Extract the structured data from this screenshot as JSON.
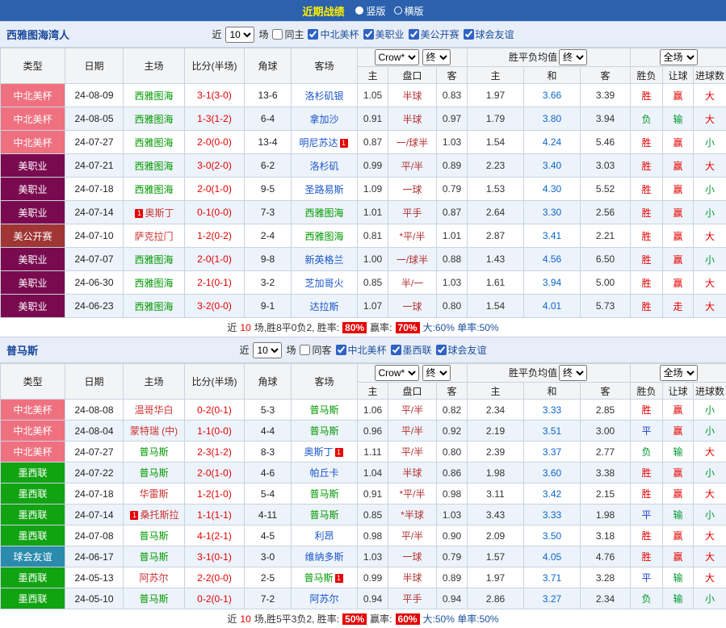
{
  "top_bar": {
    "title": "近期战绩",
    "options": [
      {
        "label": "竖版",
        "selected": true
      },
      {
        "label": "横版",
        "selected": false
      }
    ]
  },
  "headers": {
    "main": [
      "类型",
      "日期",
      "主场",
      "比分(半场)",
      "角球",
      "客场"
    ],
    "sub": [
      "主",
      "盘口",
      "客",
      "主",
      "和",
      "客",
      "胜负",
      "让球",
      "进球数"
    ],
    "odds_avg": "胜平负均值"
  },
  "controls": {
    "near": "近",
    "count": "10",
    "matches": "场",
    "company": "Crow*",
    "final": "终",
    "full": "全场"
  },
  "colors": {
    "top_bar": "#2b61ad",
    "leagues": {
      "中北美杯": "#ef7180",
      "美职业": "#7a0a50",
      "美公开赛": "#a03535",
      "墨西联": "#12a312",
      "球会友谊": "#2a8bad"
    },
    "results": {
      "胜": "#e60000",
      "赢": "#e60000",
      "大": "#e60000",
      "走": "#e60000",
      "负": "#009933",
      "输": "#009933",
      "小": "#009933",
      "平": "#2244cc"
    },
    "team": {
      "focus": "#009900",
      "home_opponent": "#cc3333",
      "away_opponent": "#1a56cc"
    }
  },
  "sections": {
    "seattle": {
      "title": "西雅图海湾人",
      "same_filter": "同主",
      "leagues": [
        {
          "name": "中北美杯"
        },
        {
          "name": "美职业"
        },
        {
          "name": "美公开赛"
        },
        {
          "name": "球会友谊"
        }
      ],
      "rows": [
        {
          "league": "中北美杯",
          "date": "24-08-09",
          "home": "西雅图海",
          "home_side": "focus",
          "score": "3-1(3-0)",
          "corners": "13-6",
          "away": "洛杉矶银",
          "away_side": "opp",
          "ah_home": "1.05",
          "ah_line": "半球",
          "ah_away": "0.83",
          "avg_home": "1.97",
          "avg_draw": "3.66",
          "avg_away": "3.39",
          "res_wdl": "胜",
          "res_ah": "赢",
          "res_goal": "大"
        },
        {
          "league": "中北美杯",
          "date": "24-08-05",
          "home": "西雅图海",
          "home_side": "focus",
          "score": "1-3(1-2)",
          "corners": "6-4",
          "away": "拿加沙",
          "away_side": "opp",
          "ah_home": "0.91",
          "ah_line": "半球",
          "ah_away": "0.97",
          "avg_home": "1.79",
          "avg_draw": "3.80",
          "avg_away": "3.94",
          "res_wdl": "负",
          "res_ah": "输",
          "res_goal": "大"
        },
        {
          "league": "中北美杯",
          "date": "24-07-27",
          "home": "西雅图海",
          "home_side": "focus",
          "score": "2-0(0-0)",
          "corners": "13-4",
          "away": "明尼苏达",
          "away_side": "opp",
          "away_card_a": "1",
          "ah_home": "0.87",
          "ah_line": "一/球半",
          "ah_away": "1.03",
          "avg_home": "1.54",
          "avg_draw": "4.24",
          "avg_away": "5.46",
          "res_wdl": "胜",
          "res_ah": "赢",
          "res_goal": "小"
        },
        {
          "league": "美职业",
          "date": "24-07-21",
          "home": "西雅图海",
          "home_side": "focus",
          "score": "3-0(2-0)",
          "corners": "6-2",
          "away": "洛杉矶",
          "away_side": "opp",
          "ah_home": "0.99",
          "ah_line": "平/半",
          "ah_away": "0.89",
          "avg_home": "2.23",
          "avg_draw": "3.40",
          "avg_away": "3.03",
          "res_wdl": "胜",
          "res_ah": "赢",
          "res_goal": "大"
        },
        {
          "league": "美职业",
          "date": "24-07-18",
          "home": "西雅图海",
          "home_side": "focus",
          "score": "2-0(1-0)",
          "corners": "9-5",
          "away": "圣路易斯",
          "away_side": "opp",
          "ah_home": "1.09",
          "ah_line": "一球",
          "ah_away": "0.79",
          "avg_home": "1.53",
          "avg_draw": "4.30",
          "avg_away": "5.52",
          "res_wdl": "胜",
          "res_ah": "赢",
          "res_goal": "小"
        },
        {
          "league": "美职业",
          "date": "24-07-14",
          "home": "奥斯丁",
          "home_side": "opp",
          "home_card_b": "1",
          "score": "0-1(0-0)",
          "corners": "7-3",
          "away": "西雅图海",
          "away_side": "focus",
          "ah_home": "1.01",
          "ah_line": "平手",
          "ah_away": "0.87",
          "avg_home": "2.64",
          "avg_draw": "3.30",
          "avg_away": "2.56",
          "res_wdl": "胜",
          "res_ah": "赢",
          "res_goal": "小"
        },
        {
          "league": "美公开赛",
          "date": "24-07-10",
          "home": "萨克拉门",
          "home_side": "opp",
          "score": "1-2(0-2)",
          "corners": "2-4",
          "away": "西雅图海",
          "away_side": "focus",
          "ah_home": "0.81",
          "ah_line": "*平/半",
          "ah_away": "1.01",
          "avg_home": "2.87",
          "avg_draw": "3.41",
          "avg_away": "2.21",
          "res_wdl": "胜",
          "res_ah": "赢",
          "res_goal": "大"
        },
        {
          "league": "美职业",
          "date": "24-07-07",
          "home": "西雅图海",
          "home_side": "focus",
          "score": "2-0(1-0)",
          "corners": "9-8",
          "away": "新英格兰",
          "away_side": "opp",
          "ah_home": "1.00",
          "ah_line": "一/球半",
          "ah_away": "0.88",
          "avg_home": "1.43",
          "avg_draw": "4.56",
          "avg_away": "6.50",
          "res_wdl": "胜",
          "res_ah": "赢",
          "res_goal": "小"
        },
        {
          "league": "美职业",
          "date": "24-06-30",
          "home": "西雅图海",
          "home_side": "focus",
          "score": "2-1(0-1)",
          "corners": "3-2",
          "away": "芝加哥火",
          "away_side": "opp",
          "ah_home": "0.85",
          "ah_line": "半/一",
          "ah_away": "1.03",
          "avg_home": "1.61",
          "avg_draw": "3.94",
          "avg_away": "5.00",
          "res_wdl": "胜",
          "res_ah": "赢",
          "res_goal": "大"
        },
        {
          "league": "美职业",
          "date": "24-06-23",
          "home": "西雅图海",
          "home_side": "focus",
          "score": "3-2(0-0)",
          "corners": "9-1",
          "away": "达拉斯",
          "away_side": "opp",
          "ah_home": "1.07",
          "ah_line": "一球",
          "ah_away": "0.80",
          "avg_home": "1.54",
          "avg_draw": "4.01",
          "avg_away": "5.73",
          "res_wdl": "胜",
          "res_ah": "走",
          "res_goal": "大"
        }
      ],
      "summary": {
        "prefix": "近",
        "count": "10",
        "mid": "场,胜8平0负2, 胜率:",
        "rate1": "80%",
        "label2": "赢率:",
        "rate2": "70%",
        "tail": "大:60% 单率:50%"
      }
    },
    "pumas": {
      "title": "普马斯",
      "same_filter": "同客",
      "leagues": [
        {
          "name": "中北美杯"
        },
        {
          "name": "墨西联"
        },
        {
          "name": "球会友谊"
        }
      ],
      "rows": [
        {
          "league": "中北美杯",
          "date": "24-08-08",
          "home": "温哥华白",
          "home_side": "opp",
          "score": "0-2(0-1)",
          "corners": "5-3",
          "away": "普马斯",
          "away_side": "focus",
          "ah_home": "1.06",
          "ah_line": "平/半",
          "ah_away": "0.82",
          "avg_home": "2.34",
          "avg_draw": "3.33",
          "avg_away": "2.85",
          "res_wdl": "胜",
          "res_ah": "赢",
          "res_goal": "小"
        },
        {
          "league": "中北美杯",
          "date": "24-08-04",
          "home": "蒙特瑞 (中)",
          "home_side": "opp",
          "score": "1-1(0-0)",
          "corners": "4-4",
          "away": "普马斯",
          "away_side": "focus",
          "ah_home": "0.96",
          "ah_line": "平/半",
          "ah_away": "0.92",
          "avg_home": "2.19",
          "avg_draw": "3.51",
          "avg_away": "3.00",
          "res_wdl": "平",
          "res_ah": "赢",
          "res_goal": "小"
        },
        {
          "league": "中北美杯",
          "date": "24-07-27",
          "home": "普马斯",
          "home_side": "focus",
          "score": "2-3(1-2)",
          "corners": "8-3",
          "away": "奥斯丁",
          "away_side": "opp",
          "away_card_a": "1",
          "ah_home": "1.11",
          "ah_line": "平/半",
          "ah_away": "0.80",
          "avg_home": "2.39",
          "avg_draw": "3.37",
          "avg_away": "2.77",
          "res_wdl": "负",
          "res_ah": "输",
          "res_goal": "大"
        },
        {
          "league": "墨西联",
          "date": "24-07-22",
          "home": "普马斯",
          "home_side": "focus",
          "score": "2-0(1-0)",
          "corners": "4-6",
          "away": "帕丘卡",
          "away_side": "opp",
          "ah_home": "1.04",
          "ah_line": "半球",
          "ah_away": "0.86",
          "avg_home": "1.98",
          "avg_draw": "3.60",
          "avg_away": "3.38",
          "res_wdl": "胜",
          "res_ah": "赢",
          "res_goal": "小"
        },
        {
          "league": "墨西联",
          "date": "24-07-18",
          "home": "华雷斯",
          "home_side": "opp",
          "score": "1-2(1-0)",
          "corners": "5-4",
          "away": "普马斯",
          "away_side": "focus",
          "ah_home": "0.91",
          "ah_line": "*平/半",
          "ah_away": "0.98",
          "avg_home": "3.11",
          "avg_draw": "3.42",
          "avg_away": "2.15",
          "res_wdl": "胜",
          "res_ah": "赢",
          "res_goal": "大"
        },
        {
          "league": "墨西联",
          "date": "24-07-14",
          "home": "桑托斯拉",
          "home_side": "opp",
          "home_card_b": "1",
          "score": "1-1(1-1)",
          "corners": "4-11",
          "away": "普马斯",
          "away_side": "focus",
          "ah_home": "0.85",
          "ah_line": "*半球",
          "ah_away": "1.03",
          "avg_home": "3.43",
          "avg_draw": "3.33",
          "avg_away": "1.98",
          "res_wdl": "平",
          "res_ah": "输",
          "res_goal": "小"
        },
        {
          "league": "墨西联",
          "date": "24-07-08",
          "home": "普马斯",
          "home_side": "focus",
          "score": "4-1(2-1)",
          "corners": "4-5",
          "away": "利昂",
          "away_side": "opp",
          "ah_home": "0.98",
          "ah_line": "平/半",
          "ah_away": "0.90",
          "avg_home": "2.09",
          "avg_draw": "3.50",
          "avg_away": "3.18",
          "res_wdl": "胜",
          "res_ah": "赢",
          "res_goal": "大"
        },
        {
          "league": "球会友谊",
          "date": "24-06-17",
          "home": "普马斯",
          "home_side": "focus",
          "score": "3-1(0-1)",
          "corners": "3-0",
          "away": "维纳多斯",
          "away_side": "opp",
          "ah_home": "1.03",
          "ah_line": "一球",
          "ah_away": "0.79",
          "avg_home": "1.57",
          "avg_draw": "4.05",
          "avg_away": "4.76",
          "res_wdl": "胜",
          "res_ah": "赢",
          "res_goal": "大"
        },
        {
          "league": "墨西联",
          "date": "24-05-13",
          "home": "阿苏尔",
          "home_side": "opp",
          "score": "2-2(0-0)",
          "corners": "2-5",
          "away": "普马斯",
          "away_side": "focus",
          "away_card_a": "1",
          "ah_home": "0.99",
          "ah_line": "半球",
          "ah_away": "0.89",
          "avg_home": "1.97",
          "avg_draw": "3.71",
          "avg_away": "3.28",
          "res_wdl": "平",
          "res_ah": "输",
          "res_goal": "大"
        },
        {
          "league": "墨西联",
          "date": "24-05-10",
          "home": "普马斯",
          "home_side": "focus",
          "score": "0-2(0-1)",
          "corners": "7-2",
          "away": "阿苏尔",
          "away_side": "opp",
          "ah_home": "0.94",
          "ah_line": "平手",
          "ah_away": "0.94",
          "avg_home": "2.86",
          "avg_draw": "3.27",
          "avg_away": "2.34",
          "res_wdl": "负",
          "res_ah": "输",
          "res_goal": "小"
        }
      ],
      "summary": {
        "prefix": "近",
        "count": "10",
        "mid": "场,胜5平3负2, 胜率:",
        "rate1": "50%",
        "label2": "赢率:",
        "rate2": "60%",
        "tail": "大:50% 单率:50%"
      }
    }
  }
}
